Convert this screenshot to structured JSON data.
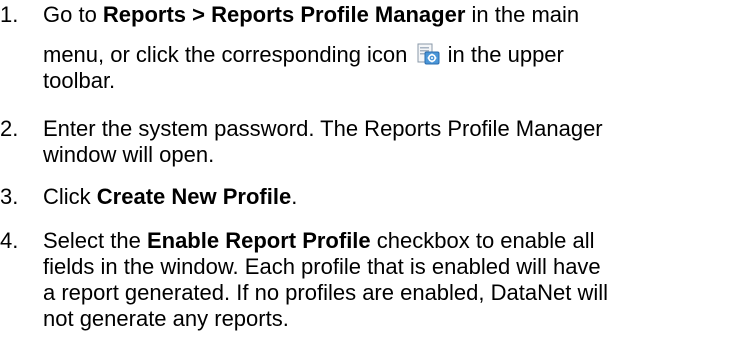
{
  "steps": [
    {
      "number": "1.",
      "line1_pre": "Go to ",
      "line1_bold": "Reports > Reports Profile Manager",
      "line1_post": " in the main",
      "line2_pre": "menu, or click the corresponding icon",
      "line2_post": "in the upper",
      "line3": "toolbar.",
      "icon": "reports-profile-manager-icon"
    },
    {
      "number": "2.",
      "line1": "Enter the system password. The Reports Profile Manager",
      "line2": "window will open."
    },
    {
      "number": "3.",
      "pre": "Click ",
      "bold": "Create New Profile",
      "post": "."
    },
    {
      "number": "4.",
      "line1_pre": "Select the ",
      "line1_bold": "Enable Report Profile",
      "line1_post": " checkbox to enable all",
      "line2": "fields in the window. Each profile that is enabled will have",
      "line3": "a report generated. If no profiles are enabled, DataNet will",
      "line4": "not generate any reports."
    }
  ]
}
